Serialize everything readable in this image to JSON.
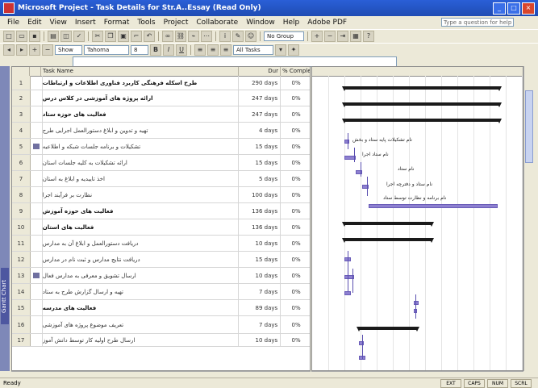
{
  "window": {
    "title": "Microsoft Project - Task Details for Str.A..Essay (Read Only)"
  },
  "menu": [
    "File",
    "Edit",
    "View",
    "Insert",
    "Format",
    "Tools",
    "Project",
    "Collaborate",
    "Window",
    "Help",
    "Adobe PDF"
  ],
  "help_box": {
    "placeholder": "Type a question for help"
  },
  "toolbar1": {
    "group_field": "No Group"
  },
  "toolbar2": {
    "show_label": "Show",
    "font": "Tahoma",
    "size": "8",
    "filter": "All Tasks"
  },
  "view_bar": {
    "label": "Gantt Chart"
  },
  "table": {
    "columns": {
      "id": "",
      "indicators": "",
      "task_name": "Task Name",
      "duration": "Dur",
      "percent": "% Complete"
    },
    "rows": [
      {
        "id": "1",
        "name": "طرح اسکله فرهنگی کاربرد فناوری اطلاعات و ارتباطات",
        "duration": "290 days",
        "pct": "0%",
        "summary": true,
        "indicator": false
      },
      {
        "id": "2",
        "name": "ارائه پروژه های آموزشی در کلاس درس",
        "duration": "247 days",
        "pct": "0%",
        "summary": true,
        "indicator": false
      },
      {
        "id": "3",
        "name": "فعالیت های حوزه ستاد",
        "duration": "247 days",
        "pct": "0%",
        "summary": true,
        "indicator": false
      },
      {
        "id": "4",
        "name": "تهیه و تدوین و ابلاغ دستورالعمل اجرایی طرح",
        "duration": "4 days",
        "pct": "0%",
        "summary": false,
        "indicator": false
      },
      {
        "id": "5",
        "name": "تشکیلات و برنامه جلسات شبکه و اطلاعیه",
        "duration": "15 days",
        "pct": "0%",
        "summary": false,
        "indicator": true
      },
      {
        "id": "6",
        "name": "ارائه تشکیلات به کلیه جلسات استان",
        "duration": "15 days",
        "pct": "0%",
        "summary": false,
        "indicator": false
      },
      {
        "id": "7",
        "name": "اخذ تاییدیه و ابلاغ به استان",
        "duration": "5 days",
        "pct": "0%",
        "summary": false,
        "indicator": false
      },
      {
        "id": "8",
        "name": "نظارت بر فرآیند اجرا",
        "duration": "100 days",
        "pct": "0%",
        "summary": false,
        "indicator": false
      },
      {
        "id": "9",
        "name": "فعالیت های حوزه آموزش",
        "duration": "136 days",
        "pct": "0%",
        "summary": true,
        "indicator": false
      },
      {
        "id": "10",
        "name": "فعالیت های استان",
        "duration": "136 days",
        "pct": "0%",
        "summary": true,
        "indicator": false
      },
      {
        "id": "11",
        "name": "دریافت دستورالعمل و ابلاغ آن به مدارس",
        "duration": "10 days",
        "pct": "0%",
        "summary": false,
        "indicator": false
      },
      {
        "id": "12",
        "name": "دریافت نتایج مدارس و ثبت نام در مدارس",
        "duration": "15 days",
        "pct": "0%",
        "summary": false,
        "indicator": false
      },
      {
        "id": "13",
        "name": "ارسال تشویق و معرفی به مدارس فعال",
        "duration": "10 days",
        "pct": "0%",
        "summary": false,
        "indicator": true
      },
      {
        "id": "14",
        "name": "تهیه و ارسال گزارش طرح به ستاد",
        "duration": "7 days",
        "pct": "0%",
        "summary": false,
        "indicator": false
      },
      {
        "id": "15",
        "name": "فعالیت های مدرسه",
        "duration": "89 days",
        "pct": "0%",
        "summary": true,
        "indicator": false
      },
      {
        "id": "16",
        "name": "تعریف موضوع پروژه های آموزشی",
        "duration": "7 days",
        "pct": "0%",
        "summary": false,
        "indicator": false
      },
      {
        "id": "17",
        "name": "ارسال طرح اولیه کار توسط دانش آموز",
        "duration": "10 days",
        "pct": "0%",
        "summary": false,
        "indicator": false
      }
    ]
  },
  "gantt_labels": {
    "l5": "نام تشکیلات پایه ستاد و بخش",
    "l6": "نام ستاد اجرا",
    "l7": "نام ستاد",
    "l8": "نام ستاد و دفترچه اجرا",
    "l9": "نام برنامه و نظارت توسط ستاد"
  },
  "status": {
    "text": "Ready",
    "cells": [
      "EXT",
      "CAPS",
      "NUM",
      "SCRL"
    ]
  }
}
